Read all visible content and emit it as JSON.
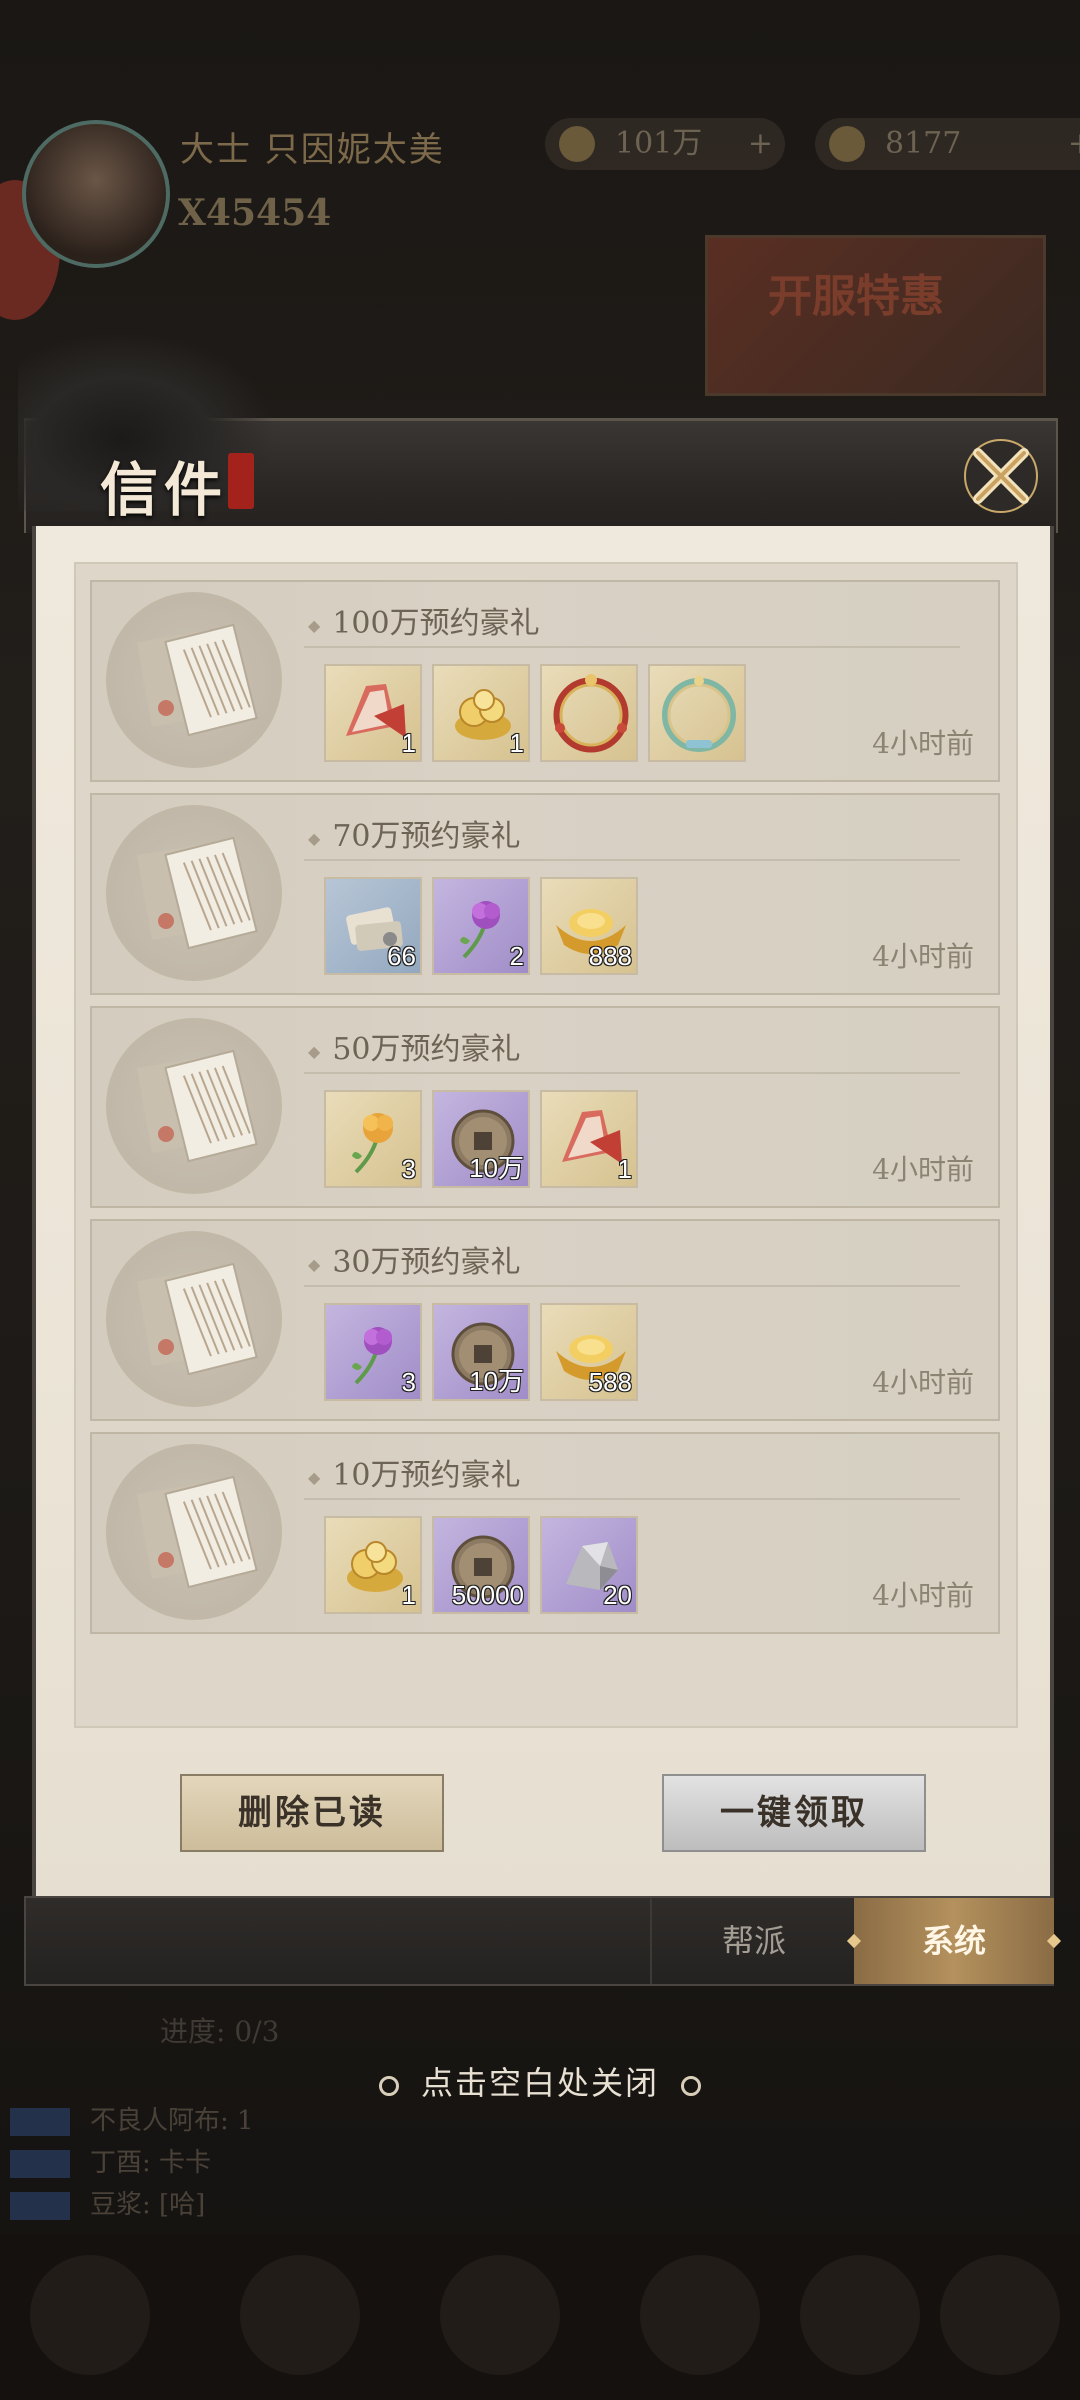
{
  "background": {
    "player_name": "大士 只因妮太美",
    "player_power": "X45454",
    "currency_1": "101万",
    "currency_2": "8177",
    "banner_text": "开服特惠",
    "progress_text": "进度: 0/3",
    "side_list": [
      "不良人阿布: 1",
      "丁酉: 卡卡",
      "豆浆: [哈]"
    ]
  },
  "dialog": {
    "title": "信件",
    "mails": [
      {
        "title": "100万预约豪礼",
        "time": "4小时前",
        "items": [
          {
            "icon": "red-fan-icon",
            "rarity": "gold",
            "count": "1"
          },
          {
            "icon": "gold-coin-pile-icon",
            "rarity": "gold",
            "count": "1"
          },
          {
            "icon": "red-ornate-frame-icon",
            "rarity": "gold",
            "count": ""
          },
          {
            "icon": "teal-ornate-frame-icon",
            "rarity": "gold",
            "count": ""
          }
        ]
      },
      {
        "title": "70万预约豪礼",
        "time": "4小时前",
        "items": [
          {
            "icon": "scroll-bundle-icon",
            "rarity": "blue",
            "count": "66"
          },
          {
            "icon": "purple-flower-icon",
            "rarity": "purple",
            "count": "2"
          },
          {
            "icon": "gold-ingot-icon",
            "rarity": "gold",
            "count": "888"
          }
        ]
      },
      {
        "title": "50万预约豪礼",
        "time": "4小时前",
        "items": [
          {
            "icon": "golden-flower-icon",
            "rarity": "gold",
            "count": "3"
          },
          {
            "icon": "copper-coin-icon",
            "rarity": "purple",
            "count": "10万"
          },
          {
            "icon": "red-fan-icon",
            "rarity": "gold",
            "count": "1"
          }
        ]
      },
      {
        "title": "30万预约豪礼",
        "time": "4小时前",
        "items": [
          {
            "icon": "purple-flower-icon",
            "rarity": "purple",
            "count": "3"
          },
          {
            "icon": "copper-coin-icon",
            "rarity": "purple",
            "count": "10万"
          },
          {
            "icon": "gold-ingot-icon",
            "rarity": "gold",
            "count": "588"
          }
        ]
      },
      {
        "title": "10万预约豪礼",
        "time": "4小时前",
        "items": [
          {
            "icon": "gold-coin-pile-icon",
            "rarity": "gold",
            "count": "1"
          },
          {
            "icon": "copper-coin-icon",
            "rarity": "purple",
            "count": "50000"
          },
          {
            "icon": "iron-ore-icon",
            "rarity": "purple",
            "count": "20"
          }
        ]
      }
    ],
    "delete_read_label": "删除已读",
    "claim_all_label": "一键领取",
    "tabs": {
      "faction": "帮派",
      "system": "系统"
    }
  },
  "close_hint": "点击空白处关闭",
  "colors": {
    "accent_gold": "#b4915d",
    "paper": "#ebe4d7",
    "header": "#2a2725"
  }
}
